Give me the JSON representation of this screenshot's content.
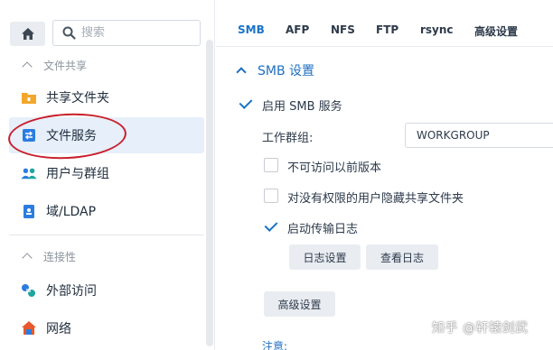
{
  "sidebar": {
    "search_placeholder": "搜索",
    "sections": [
      {
        "title": "文件共享"
      },
      {
        "title": "连接性"
      }
    ],
    "items": [
      {
        "label": "共享文件夹"
      },
      {
        "label": "文件服务"
      },
      {
        "label": "用户与群组"
      },
      {
        "label": "域/LDAP"
      },
      {
        "label": "外部访问"
      },
      {
        "label": "网络"
      }
    ],
    "active_item": "文件服务"
  },
  "tabs": [
    "SMB",
    "AFP",
    "NFS",
    "FTP",
    "rsync",
    "高级设置"
  ],
  "active_tab": "SMB",
  "smb": {
    "group_title": "SMB 设置",
    "enable_label": "启用 SMB 服务",
    "enable_checked": true,
    "workgroup_label": "工作群组:",
    "workgroup_value": "WORKGROUP",
    "options": [
      {
        "label": "不可访问以前版本",
        "checked": false
      },
      {
        "label": "对没有权限的用户隐藏共享文件夹",
        "checked": false
      },
      {
        "label": "启动传输日志",
        "checked": true
      }
    ],
    "log_settings_button": "日志设置",
    "view_log_button": "查看日志",
    "advanced_button": "高级设置",
    "note_label": "注意:"
  },
  "watermark": "知乎 @轩辕剑武",
  "colors": {
    "accent": "#1a73c7",
    "annotation": "#c8202c"
  }
}
